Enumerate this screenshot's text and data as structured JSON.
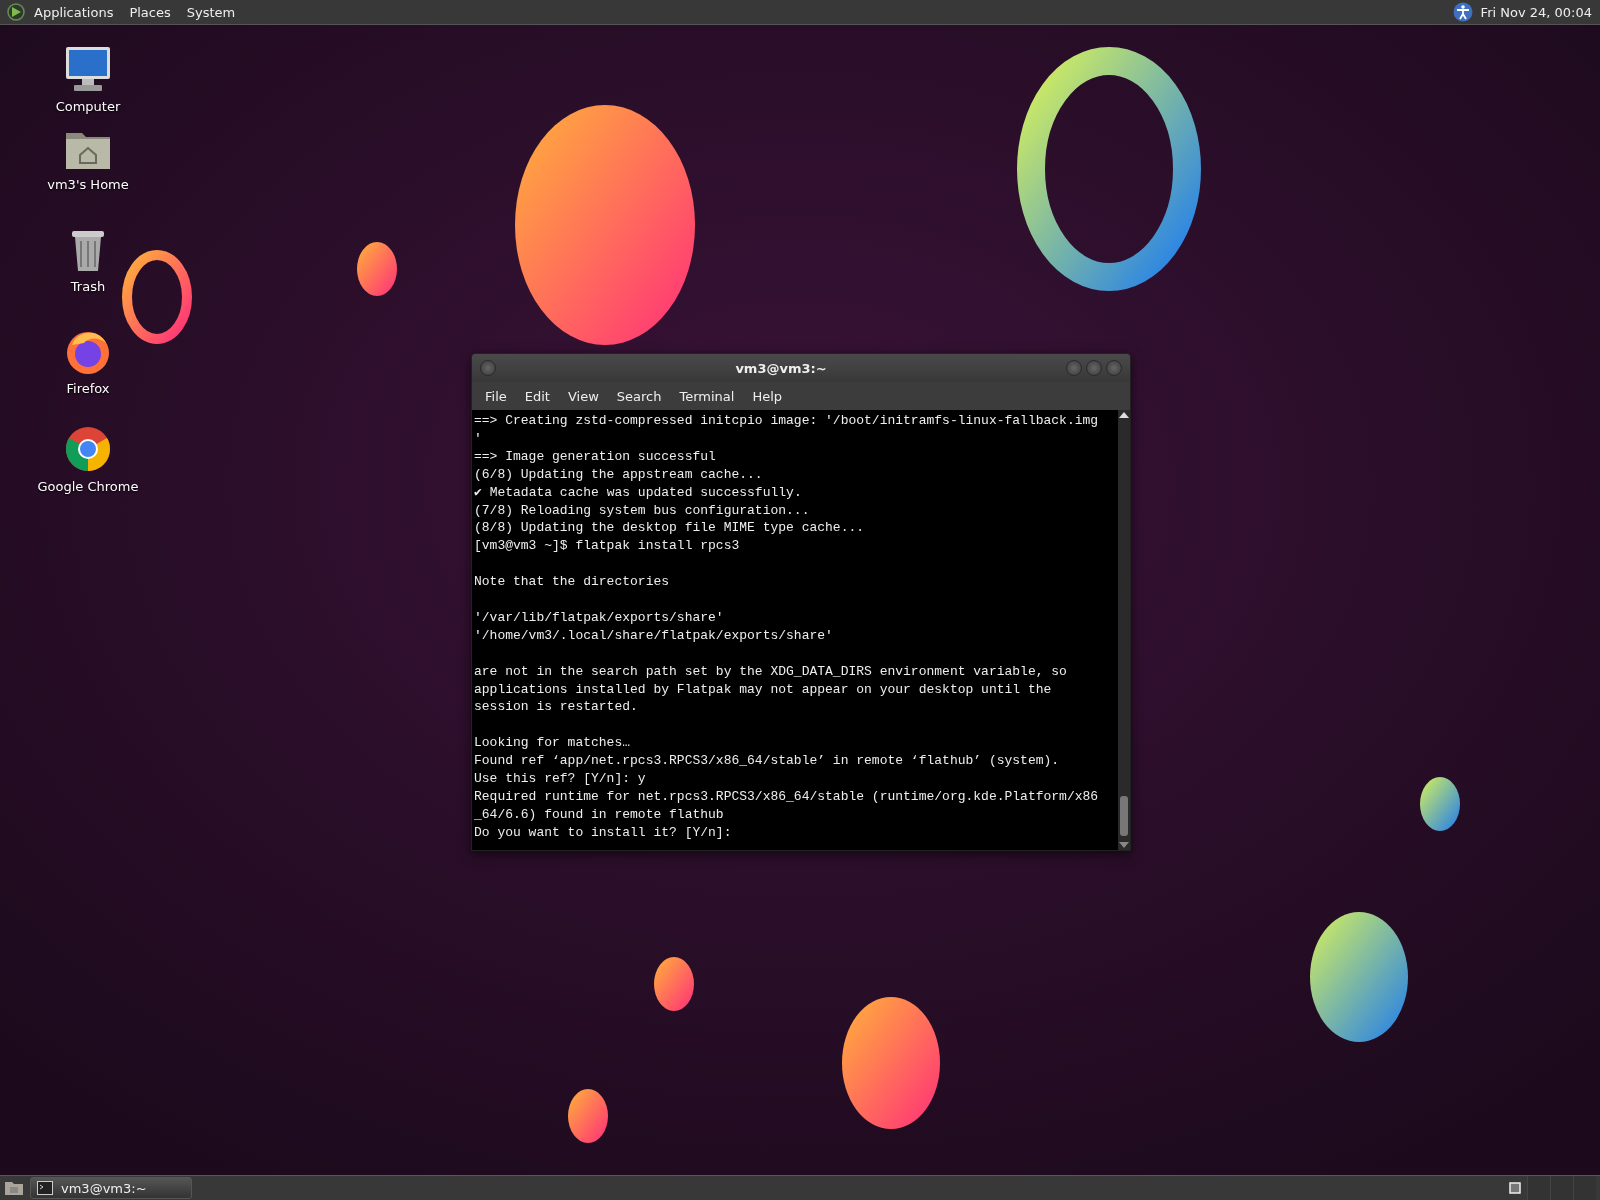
{
  "top_panel": {
    "menus": [
      "Applications",
      "Places",
      "System"
    ],
    "clock": "Fri Nov 24, 00:04"
  },
  "desktop_icons": [
    {
      "kind": "computer",
      "label": "Computer"
    },
    {
      "kind": "home",
      "label": "vm3's Home"
    },
    {
      "kind": "trash",
      "label": "Trash"
    },
    {
      "kind": "firefox",
      "label": "Firefox"
    },
    {
      "kind": "chrome",
      "label": "Google Chrome"
    }
  ],
  "terminal": {
    "title": "vm3@vm3:~",
    "menu": [
      "File",
      "Edit",
      "View",
      "Search",
      "Terminal",
      "Help"
    ],
    "blocks": [
      [
        "==> Creating zstd-compressed initcpio image: '/boot/initramfs-linux-fallback.img",
        "'",
        "==> Image generation successful",
        "(6/8) Updating the appstream cache...",
        "✔ Metadata cache was updated successfully.",
        "(7/8) Reloading system bus configuration...",
        "(8/8) Updating the desktop file MIME type cache...",
        "[vm3@vm3 ~]$ flatpak install rpcs3"
      ],
      [
        "Note that the directories"
      ],
      [
        "'/var/lib/flatpak/exports/share'",
        "'/home/vm3/.local/share/flatpak/exports/share'"
      ],
      [
        "are not in the search path set by the XDG_DATA_DIRS environment variable, so",
        "applications installed by Flatpak may not appear on your desktop until the",
        "session is restarted."
      ],
      [
        "Looking for matches…",
        "Found ref ‘app/net.rpcs3.RPCS3/x86_64/stable’ in remote ‘flathub’ (system).",
        "Use this ref? [Y/n]: y",
        "Required runtime for net.rpcs3.RPCS3/x86_64/stable (runtime/org.kde.Platform/x86",
        "_64/6.6) found in remote flathub",
        "Do you want to install it? [Y/n]:"
      ]
    ]
  },
  "taskbar": {
    "windows": [
      {
        "title": "vm3@vm3:~",
        "selected": true
      }
    ]
  }
}
